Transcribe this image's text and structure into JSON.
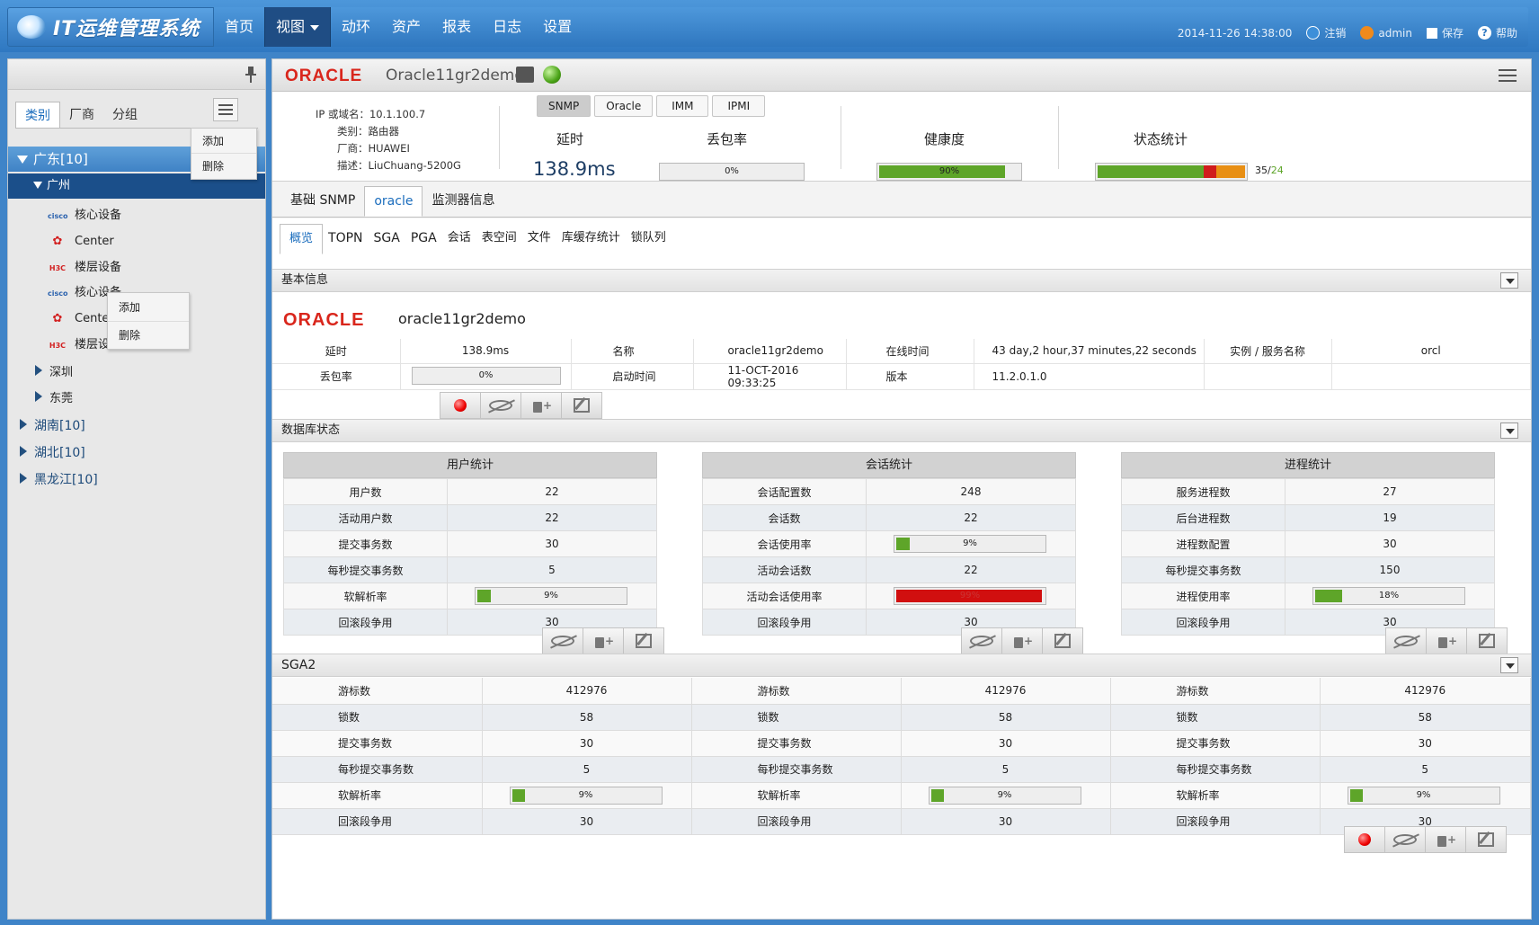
{
  "app": {
    "title": "IT运维管理系统"
  },
  "nav": {
    "items": [
      "首页",
      "视图",
      "动环",
      "资产",
      "报表",
      "日志",
      "设置"
    ],
    "active": "视图"
  },
  "header_right": {
    "datetime": "2014-11-26 14:38:00",
    "logout": "注销",
    "user": "admin",
    "save": "保存",
    "help": "帮助"
  },
  "left": {
    "tabs": [
      "类别",
      "厂商",
      "分组"
    ],
    "menu1": {
      "add": "添加",
      "delete": "删除"
    },
    "menu2": {
      "add": "添加",
      "delete": "删除"
    },
    "tree": {
      "guangdong": "广东[10]",
      "guangzhou": "广州",
      "devices": [
        {
          "brand": "cisco",
          "label": "核心设备"
        },
        {
          "brand": "huawei",
          "label": "Center"
        },
        {
          "brand": "h3c",
          "label": "楼层设备"
        },
        {
          "brand": "cisco",
          "label": "核心设备"
        },
        {
          "brand": "huawei",
          "label": "Center"
        },
        {
          "brand": "h3c",
          "label": "楼层设备"
        }
      ],
      "shenzhen": "深圳",
      "dongguan": "东莞",
      "hunan": "湖南[10]",
      "hubei": "湖北[10]",
      "heilongjiang": "黑龙江[10]"
    }
  },
  "device": {
    "logo": "ORACLE",
    "name": "Oracle11gr2demo",
    "protocols": [
      "SNMP",
      "Oracle",
      "IMM",
      "IPMI"
    ],
    "info": {
      "ip_label": "IP 或域名：",
      "ip": "10.1.100.7",
      "type_label": "类别：",
      "type": "路由器",
      "vendor_label": "厂商：",
      "vendor": "HUAWEI",
      "desc_label": "描述：",
      "desc": "LiuChuang-5200G"
    },
    "latency_label": "延时",
    "latency": "138.9ms",
    "loss_label": "丢包率",
    "loss": "0%",
    "loss_value": 0,
    "health_label": "健康度",
    "health": "90%",
    "health_value": 0.9,
    "status_label": "状态统计",
    "status_ok": "35",
    "status_total": "24"
  },
  "tabs_main": [
    "基础 SNMP",
    "oracle",
    "监测器信息"
  ],
  "tabs_sub": [
    "概览",
    "TOPN",
    "SGA",
    "PGA",
    "会话",
    "表空间",
    "文件",
    "库缓存统计",
    "锁队列"
  ],
  "basic": {
    "title": "基本信息",
    "logo": "ORACLE",
    "name": "oracle11gr2demo",
    "row1": [
      "延时",
      "138.9ms",
      "名称",
      "oracle11gr2demo",
      "在线时间",
      "43 day,2 hour,37 minutes,22 seconds",
      "实例 / 服务名称",
      "orcl"
    ],
    "row2": [
      "丢包率",
      "0%",
      "启动时间",
      "11-OCT-2016 09:33:25",
      "版本",
      "11.2.0.1.0"
    ]
  },
  "dbstatus": {
    "title": "数据库状态",
    "user": {
      "title": "用户统计",
      "rows": [
        [
          "用户数",
          "22"
        ],
        [
          "活动用户数",
          "22"
        ],
        [
          "提交事务数",
          "30"
        ],
        [
          "每秒提交事务数",
          "5"
        ],
        [
          "软解析率",
          "9%"
        ],
        [
          "回滚段争用",
          "30"
        ]
      ],
      "soft_parse": 0.09
    },
    "session": {
      "title": "会话统计",
      "rows": [
        [
          "会话配置数",
          "248"
        ],
        [
          "会话数",
          "22"
        ],
        [
          "会话使用率",
          "9%"
        ],
        [
          "活动会话数",
          "22"
        ],
        [
          "活动会话使用率",
          "99%"
        ],
        [
          "回滚段争用",
          "30"
        ]
      ],
      "usage": 0.09,
      "active_usage": 0.99
    },
    "process": {
      "title": "进程统计",
      "rows": [
        [
          "服务进程数",
          "27"
        ],
        [
          "后台进程数",
          "19"
        ],
        [
          "进程数配置",
          "30"
        ],
        [
          "每秒提交事务数",
          "150"
        ],
        [
          "进程使用率",
          "18%"
        ],
        [
          "回滚段争用",
          "30"
        ]
      ],
      "usage": 0.18
    }
  },
  "sga2": {
    "title": "SGA2",
    "rows": [
      [
        "游标数",
        "412976"
      ],
      [
        "锁数",
        "58"
      ],
      [
        "提交事务数",
        "30"
      ],
      [
        "每秒提交事务数",
        "5"
      ],
      [
        "软解析率",
        "9%"
      ],
      [
        "回滚段争用",
        "30"
      ]
    ],
    "soft_parse": 0.09
  }
}
